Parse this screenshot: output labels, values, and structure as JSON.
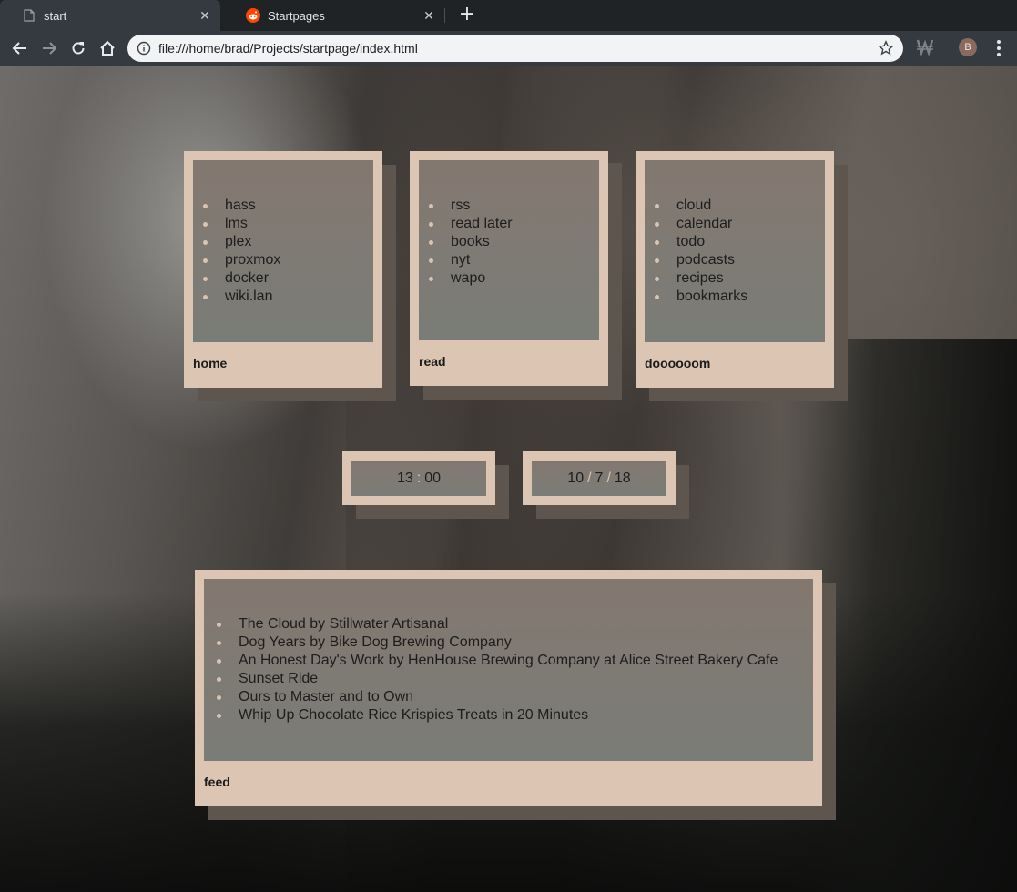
{
  "browser": {
    "tabs": [
      {
        "title": "start",
        "icon": "page-icon",
        "active": true
      },
      {
        "title": "Startpages",
        "icon": "reddit-icon",
        "active": false
      }
    ],
    "url": "file:///home/brad/Projects/startpage/index.html",
    "avatar_letter": "B"
  },
  "cards": {
    "home": {
      "caption": "home",
      "links": [
        "hass",
        "lms",
        "plex",
        "proxmox",
        "docker",
        "wiki.lan"
      ]
    },
    "read": {
      "caption": "read",
      "links": [
        "rss",
        "read later",
        "books",
        "nyt",
        "wapo"
      ]
    },
    "doom": {
      "caption": "doooooom",
      "links": [
        "cloud",
        "calendar",
        "todo",
        "podcasts",
        "recipes",
        "bookmarks"
      ]
    }
  },
  "clock": {
    "hours": "13",
    "minutes": "00",
    "time_separator": ":"
  },
  "date": {
    "day": "10",
    "month": "7",
    "year": "18",
    "separator": "/"
  },
  "feed": {
    "caption": "feed",
    "items": [
      "The Cloud by Stillwater Artisanal",
      "Dog Years by Bike Dog Brewing Company",
      "An Honest Day's Work by HenHouse Brewing Company at Alice Street Bakery Cafe",
      "Sunset Ride",
      "Ours to Master and to Own",
      "Whip Up Chocolate Rice Krispies Treats in 20 Minutes"
    ]
  },
  "colors": {
    "card_frame": "#dcc5b3",
    "card_shadow": "#5e554f",
    "card_inner_top": "#837870",
    "card_inner_bottom": "#7a7c77"
  }
}
